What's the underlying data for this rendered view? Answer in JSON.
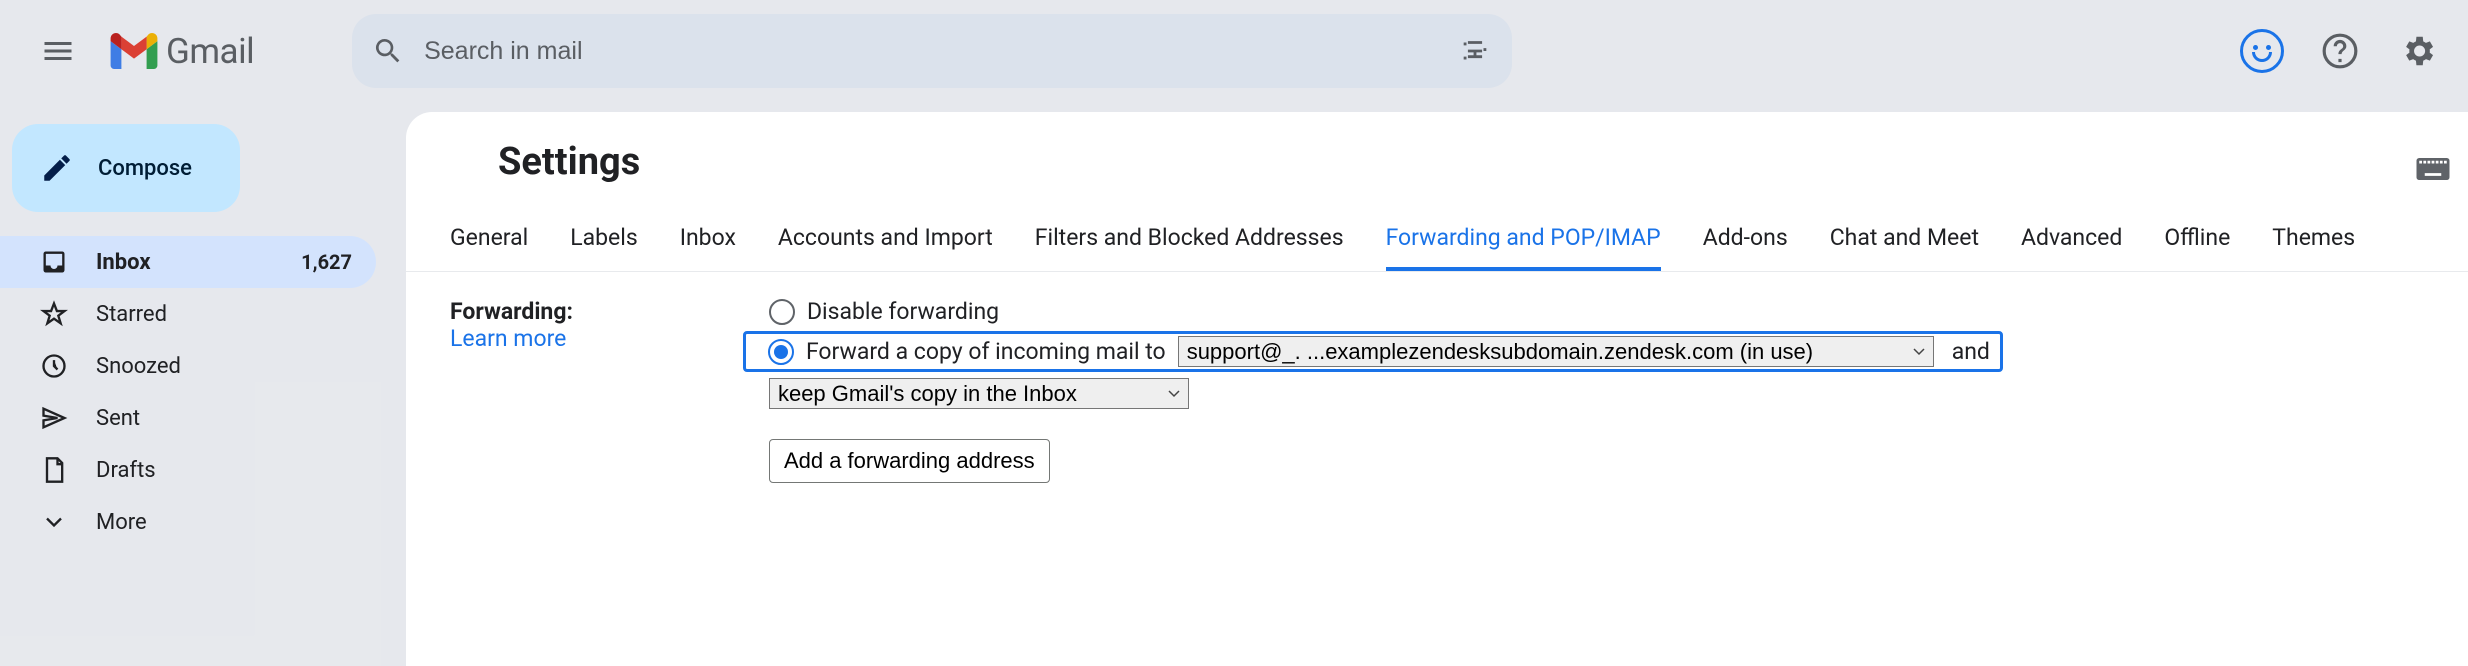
{
  "header": {
    "app_name": "Gmail",
    "search_placeholder": "Search in mail"
  },
  "sidebar": {
    "compose_label": "Compose",
    "items": [
      {
        "label": "Inbox",
        "count": "1,627",
        "active": true
      },
      {
        "label": "Starred"
      },
      {
        "label": "Snoozed"
      },
      {
        "label": "Sent"
      },
      {
        "label": "Drafts"
      },
      {
        "label": "More"
      }
    ]
  },
  "main": {
    "title": "Settings",
    "tabs": [
      "General",
      "Labels",
      "Inbox",
      "Accounts and Import",
      "Filters and Blocked Addresses",
      "Forwarding and POP/IMAP",
      "Add-ons",
      "Chat and Meet",
      "Advanced",
      "Offline",
      "Themes"
    ],
    "active_tab": "Forwarding and POP/IMAP",
    "forwarding": {
      "section_label": "Forwarding:",
      "learn_more": "Learn more",
      "disable_label": "Disable forwarding",
      "forward_label": "Forward a copy of incoming mail to",
      "forward_address_option": "support@_. ...examplezendesksubdomain.zendesk.com (in use)",
      "and": "and",
      "copy_option": "keep Gmail's copy in the Inbox",
      "add_address_label": "Add a forwarding address"
    }
  }
}
